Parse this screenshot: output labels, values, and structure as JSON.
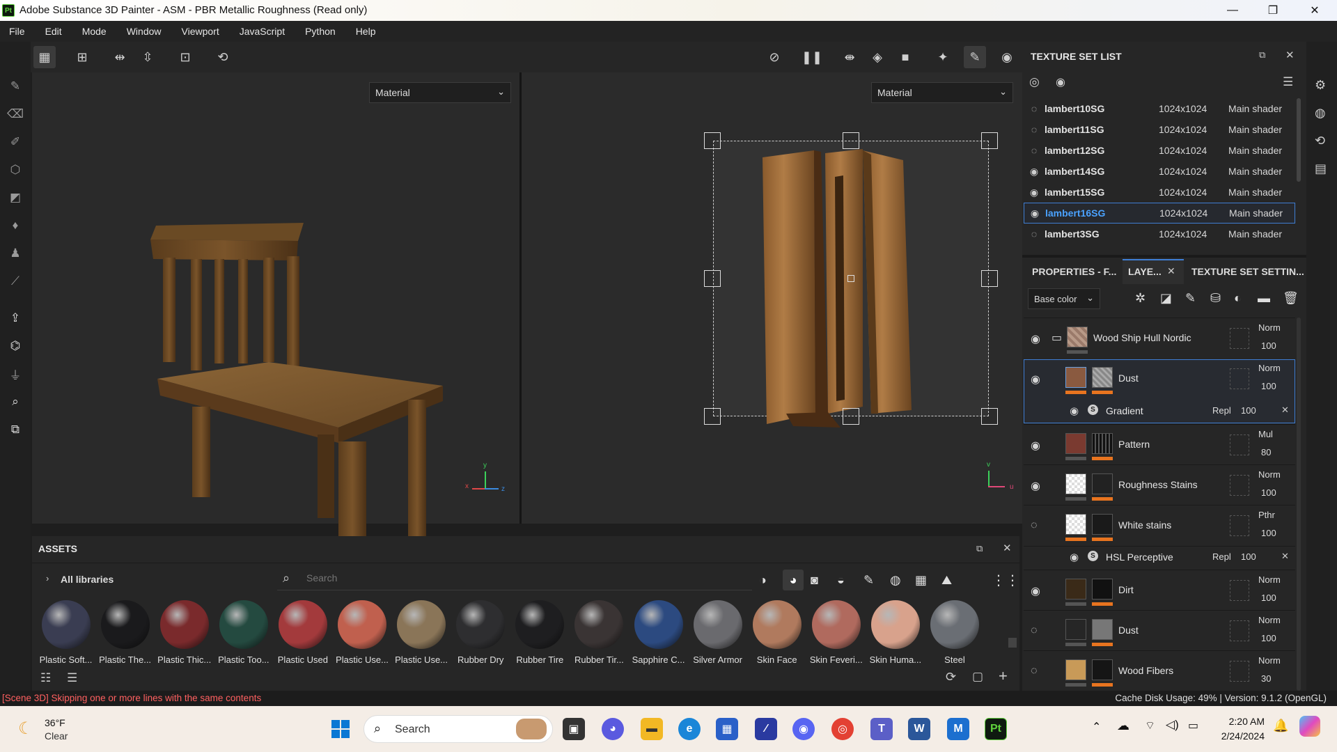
{
  "window": {
    "title": "Adobe Substance 3D Painter - ASM - PBR Metallic Roughness (Read only)",
    "logo": "Pt",
    "controls": [
      "—",
      "❐",
      "✕"
    ]
  },
  "menu": [
    "File",
    "Edit",
    "Mode",
    "Window",
    "Viewport",
    "JavaScript",
    "Python",
    "Help"
  ],
  "viewport": {
    "left_display": "Material",
    "right_display": "Material",
    "left_axes": {
      "x": "x",
      "y": "y",
      "z": "z"
    },
    "right_axes": {
      "v": "v",
      "u": "u"
    }
  },
  "texture_set_list": {
    "title": "TEXTURE SET LIST",
    "rows": [
      {
        "name": "lambert10SG",
        "size": "1024x1024",
        "shader": "Main shader",
        "visible": false
      },
      {
        "name": "lambert11SG",
        "size": "1024x1024",
        "shader": "Main shader",
        "visible": false
      },
      {
        "name": "lambert12SG",
        "size": "1024x1024",
        "shader": "Main shader",
        "visible": false
      },
      {
        "name": "lambert14SG",
        "size": "1024x1024",
        "shader": "Main shader",
        "visible": true
      },
      {
        "name": "lambert15SG",
        "size": "1024x1024",
        "shader": "Main shader",
        "visible": true
      },
      {
        "name": "lambert16SG",
        "size": "1024x1024",
        "shader": "Main shader",
        "visible": true,
        "selected": true
      },
      {
        "name": "lambert3SG",
        "size": "1024x1024",
        "shader": "Main shader",
        "visible": false
      }
    ]
  },
  "tabs": {
    "properties": "PROPERTIES - F...",
    "layers": "LAYE...",
    "texture_set_settings": "TEXTURE SET SETTIN..."
  },
  "layers_toolbar": {
    "channel": "Base color"
  },
  "layers": [
    {
      "name": "Wood Ship Hull Nordic",
      "blend": "Norm",
      "opacity": "100",
      "folder": true,
      "visible": true
    },
    {
      "name": "Dust",
      "blend": "Norm",
      "opacity": "100",
      "visible": true,
      "selected": true
    },
    {
      "name": "Pattern",
      "blend": "Mul",
      "opacity": "80",
      "visible": true
    },
    {
      "name": "Roughness Stains",
      "blend": "Norm",
      "opacity": "100",
      "visible": true
    },
    {
      "name": "White stains",
      "blend": "Pthr",
      "opacity": "100",
      "visible": false
    },
    {
      "name": "Dirt",
      "blend": "Norm",
      "opacity": "100",
      "visible": true
    },
    {
      "name": "Dust",
      "blend": "Norm",
      "opacity": "100",
      "visible": false
    },
    {
      "name": "Wood Fibers",
      "blend": "Norm",
      "opacity": "30",
      "visible": false
    }
  ],
  "effects": [
    {
      "name": "Gradient",
      "blend": "Repl",
      "opacity": "100"
    },
    {
      "name": "HSL Perceptive",
      "blend": "Repl",
      "opacity": "100"
    }
  ],
  "assets": {
    "title": "ASSETS",
    "library": "All libraries",
    "search_placeholder": "Search",
    "materials": [
      {
        "label": "Plastic Soft...",
        "color": "#3a3d52"
      },
      {
        "label": "Plastic The...",
        "color": "#1a1a1c"
      },
      {
        "label": "Plastic Thic...",
        "color": "#7a2a2c"
      },
      {
        "label": "Plastic Too...",
        "color": "#244a40"
      },
      {
        "label": "Plastic Used",
        "color": "#a33a3c"
      },
      {
        "label": "Plastic Use...",
        "color": "#c0604e"
      },
      {
        "label": "Plastic Use...",
        "color": "#8a7558"
      },
      {
        "label": "Rubber Dry",
        "color": "#2e2e30"
      },
      {
        "label": "Rubber Tire",
        "color": "#1e1e20"
      },
      {
        "label": "Rubber Tir...",
        "color": "#3a3434"
      },
      {
        "label": "Sapphire C...",
        "color": "#2c4a80"
      },
      {
        "label": "Silver Armor",
        "color": "#6a6a6e"
      },
      {
        "label": "Skin Face",
        "color": "#b07a5e"
      },
      {
        "label": "Skin Feveri...",
        "color": "#b06a5e"
      },
      {
        "label": "Skin Huma...",
        "color": "#d8a28c"
      },
      {
        "label": "Steel",
        "color": "#6a6e74"
      }
    ]
  },
  "status": {
    "message": "[Scene 3D] Skipping one or more lines with the same contents",
    "right": "Cache Disk Usage:  49% | Version: 9.1.2 (OpenGL)"
  },
  "taskbar": {
    "temp": "36°F",
    "weather": "Clear",
    "search": "Search",
    "time": "2:20 AM",
    "date": "2/24/2024"
  }
}
